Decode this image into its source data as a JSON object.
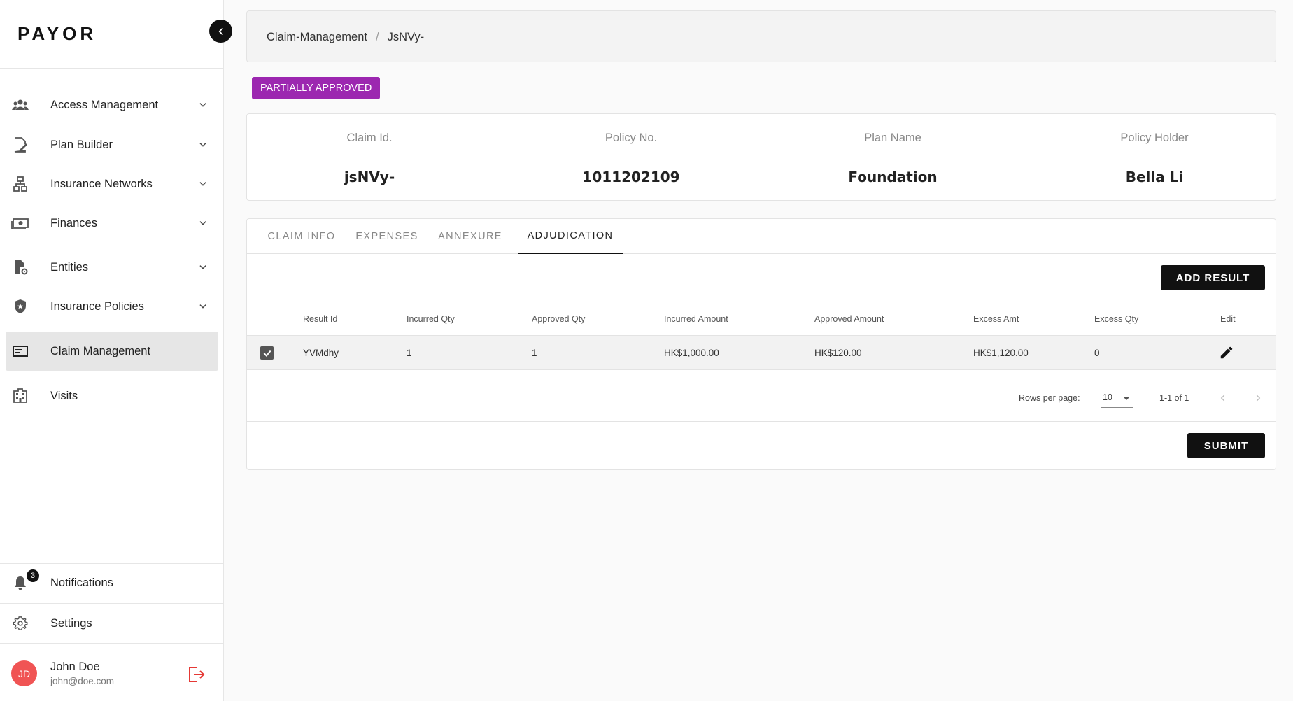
{
  "app": {
    "logo": "PAYOR"
  },
  "sidebar": {
    "items": [
      {
        "label": "Access Management",
        "icon": "users-icon",
        "expandable": true
      },
      {
        "label": "Plan Builder",
        "icon": "document-edit-icon",
        "expandable": true
      },
      {
        "label": "Insurance Networks",
        "icon": "network-icon",
        "expandable": true
      },
      {
        "label": "Finances",
        "icon": "money-icon",
        "expandable": true
      },
      {
        "label": "Entities",
        "icon": "document-gear-icon",
        "expandable": true
      },
      {
        "label": "Insurance Policies",
        "icon": "shield-icon",
        "expandable": true
      },
      {
        "label": "Claim Management",
        "icon": "card-icon",
        "expandable": false,
        "active": true
      },
      {
        "label": "Visits",
        "icon": "building-icon",
        "expandable": false
      }
    ],
    "notifications": {
      "label": "Notifications",
      "count": "3"
    },
    "settings": {
      "label": "Settings"
    },
    "user": {
      "initials": "JD",
      "name": "John Doe",
      "email": "john@doe.com"
    }
  },
  "breadcrumb": {
    "parent": "Claim-Management",
    "separator": "/",
    "current": "JsNVy-"
  },
  "status": {
    "label": "PARTIALLY APPROVED",
    "color": "#9c27b0"
  },
  "info": [
    {
      "label": "Claim Id.",
      "value": "jsNVy-"
    },
    {
      "label": "Policy No.",
      "value": "1011202109"
    },
    {
      "label": "Plan Name",
      "value": "Foundation"
    },
    {
      "label": "Policy Holder",
      "value": "Bella Li"
    }
  ],
  "tabs": [
    {
      "label": "CLAIM INFO"
    },
    {
      "label": "EXPENSES"
    },
    {
      "label": "ANNEXURE"
    },
    {
      "label": "ADJUDICATION",
      "active": true
    }
  ],
  "actions": {
    "add_result": "ADD RESULT",
    "submit": "SUBMIT"
  },
  "table": {
    "headers": [
      "Result Id",
      "Incurred Qty",
      "Approved Qty",
      "Incurred Amount",
      "Approved Amount",
      "Excess Amt",
      "Excess Qty",
      "Edit"
    ],
    "rows": [
      {
        "checked": true,
        "cells": [
          "YVMdhy",
          "1",
          "1",
          "HK$1,000.00",
          "HK$120.00",
          "HK$1,120.00",
          "0"
        ]
      }
    ]
  },
  "pagination": {
    "rows_per_page_label": "Rows per page:",
    "rows_per_page": "10",
    "range": "1-1 of 1"
  }
}
